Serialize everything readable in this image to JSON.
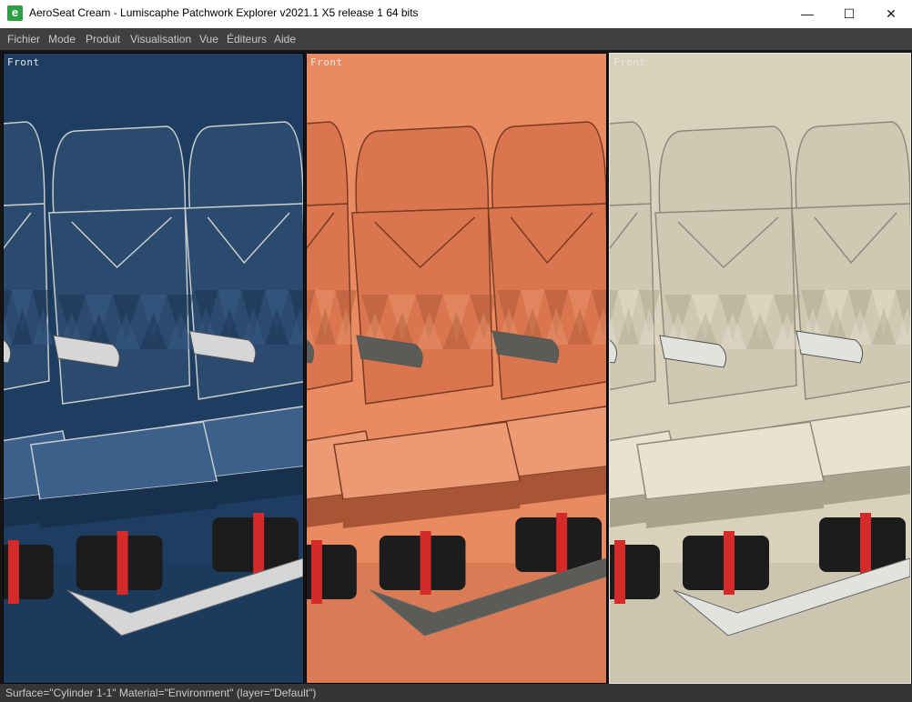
{
  "window": {
    "title": "AeroSeat Cream - Lumiscaphe Patchwork Explorer v2021.1 X5 release 1 64 bits",
    "app_icon_letter": "e",
    "minimize_glyph": "—",
    "maximize_glyph": "☐",
    "close_glyph": "✕"
  },
  "menu": {
    "items": [
      {
        "label": "Fichier"
      },
      {
        "label": "Mode"
      },
      {
        "label": "Produit"
      },
      {
        "label": "Visualisation"
      },
      {
        "label": "Vue"
      },
      {
        "label": "Éditeurs"
      },
      {
        "label": "Aide"
      }
    ]
  },
  "viewports": [
    {
      "label": "Front",
      "variant": "navy",
      "bg": "#1d3e61",
      "fabric": "#2a4a6e",
      "fabric_light": "#3c6089",
      "fabric_dark": "#16304e",
      "piping": "#c9ccd0",
      "arm": "#d4d6d8",
      "active": false
    },
    {
      "label": "Front",
      "variant": "coral",
      "bg": "#ea8a60",
      "fabric": "#d9764f",
      "fabric_light": "#ec9a73",
      "fabric_dark": "#a85535",
      "piping": "#7a3a22",
      "arm": "#5b5b57",
      "active": false
    },
    {
      "label": "Front",
      "variant": "cream",
      "bg": "#d9d1bb",
      "fabric": "#cfc8b2",
      "fabric_light": "#e8e2cf",
      "fabric_dark": "#a9a28c",
      "piping": "#8f8a78",
      "arm": "#e2e2de",
      "active": true
    }
  ],
  "status": {
    "text": "Surface=\"Cylinder 1-1\" Material=\"Environment\" (layer=\"Default\")"
  },
  "colors": {
    "strap": "#d42a2a",
    "box": "#1c1c1c"
  }
}
